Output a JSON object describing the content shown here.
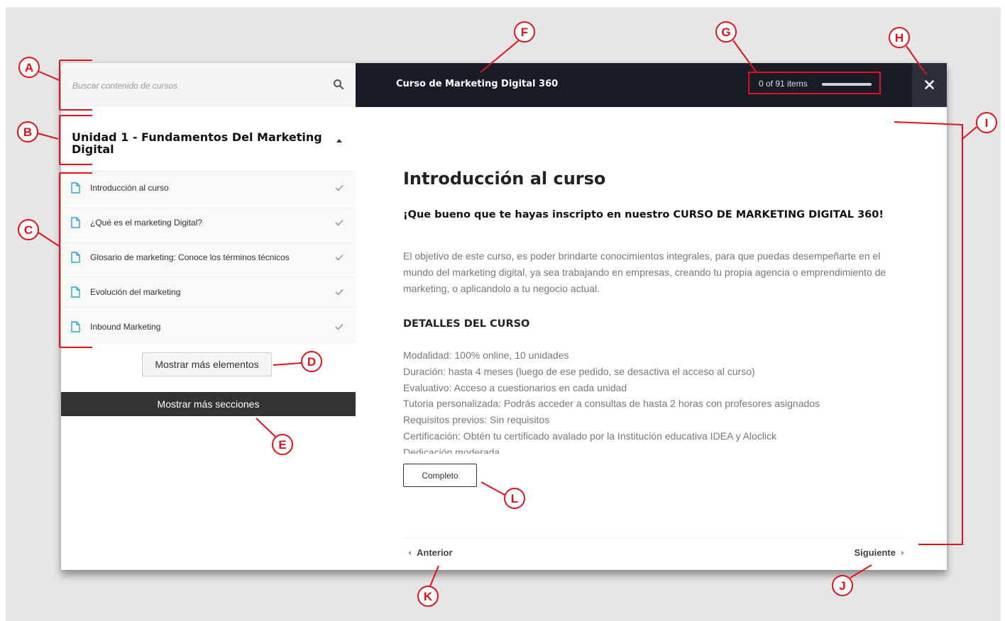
{
  "search": {
    "placeholder": "Buscar contenido de cursos",
    "icon": "search-icon"
  },
  "section": {
    "title": "Unidad 1 - Fundamentos Del Marketing Digital"
  },
  "lessons": [
    {
      "label": "Introducción al curso",
      "completed": true
    },
    {
      "label": "¿Qué es el marketing Digital?",
      "completed": true
    },
    {
      "label": "Glosario de marketing: Conoce los términos técnicos",
      "completed": true
    },
    {
      "label": "Evolución del marketing",
      "completed": true
    },
    {
      "label": "Inbound Marketing",
      "completed": true
    }
  ],
  "buttons": {
    "more_items": "Mostrar más elementos",
    "more_sections": "Mostrar más secciones",
    "complete": "Completo",
    "prev": "Anterior",
    "next": "Siguiente"
  },
  "header": {
    "course_title": "Curso de Marketing Digital 360",
    "progress_text": "0 of 91 items",
    "progress_fraction": 0
  },
  "content": {
    "title": "Introducción al curso",
    "welcome": "¡Que bueno que te hayas inscripto en nuestro CURSO DE MARKETING DIGITAL 360!",
    "intro": "El objetivo de este curso, es poder brindarte conocimientos integrales, para que puedas desempeñarte en el mundo del marketing digital, ya sea trabajando en empresas, creando tu propia agencia o emprendimiento de marketing, o aplicandolo a tu negocio actual.",
    "details_heading": "DETALLES DEL CURSO",
    "details": [
      "Modalidad: 100% online, 10 unidades",
      "Duración: hasta 4 meses (luego de ese pedido, se desactiva el acceso al curso)",
      "Evaluativo: Acceso a cuestionarios en cada unidad",
      "Tutoria personalizada: Podrás acceder a consultas de hasta 2 horas con profesores asignados",
      "Requisitos previos: Sin requisitos",
      "Certificación: Obtén tu certificado avalado por la Institución educativa IDEA y Aloclick",
      "Dedicación moderada"
    ]
  },
  "annotations": {
    "labels": [
      "A",
      "B",
      "C",
      "D",
      "E",
      "F",
      "G",
      "H",
      "I",
      "J",
      "K",
      "L"
    ],
    "color": "#e0131b"
  },
  "colors": {
    "header_bg": "#191c26",
    "accent": "#2aa6d8",
    "dark_button": "#333333"
  }
}
